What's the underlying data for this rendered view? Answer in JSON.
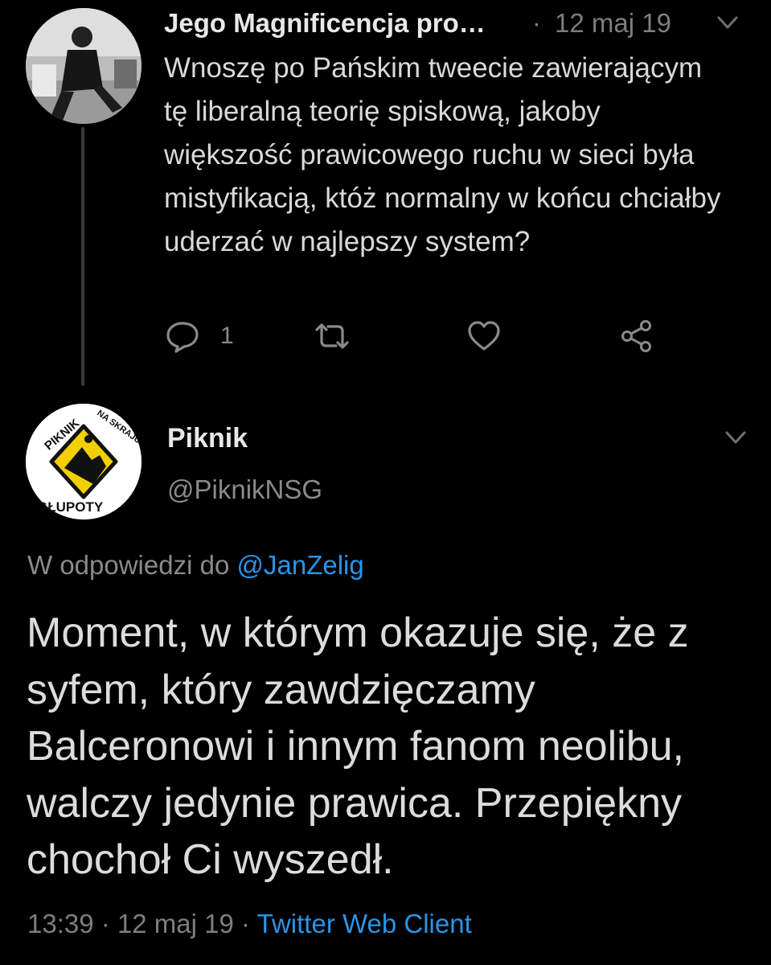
{
  "tweet1": {
    "author_name": "Jego Magnificencja pro…",
    "separator": "·",
    "date": "12 maj 19",
    "text": "Wnoszę po Pańskim tweecie zawierającym tę liberalną teorię spiskową, jakoby większość prawicowego ruchu w sieci była mistyfikacją, któż normalny w końcu chciałby uderzać w najlepszy system?",
    "reply_count": "1",
    "icons": {
      "more": "chevron-down-icon",
      "reply": "reply-icon",
      "retweet": "retweet-icon",
      "like": "heart-icon",
      "share": "share-icon"
    }
  },
  "tweet2": {
    "author_name": "Piknik",
    "handle": "@PiknikNSG",
    "avatar_text": [
      "PIKNIK",
      "NA SKRAJU",
      "GŁUPOTY"
    ],
    "reply_prefix": "W odpowiedzi do",
    "reply_mention": "@JanZelig",
    "text": "Moment, w którym okazuje się, że z syfem, który zawdzięczamy Balceronowi i innym fanom neolibu, walczy jedynie prawica. Przepiękny chochoł Ci wyszedł.",
    "time": "13:39",
    "separator": "·",
    "date": "12 maj 19",
    "separator2": "·",
    "client": "Twitter Web Client"
  },
  "colors": {
    "background": "#000000",
    "text": "#d9d9d9",
    "muted": "#7e7e7e",
    "link": "#2b94e6",
    "avatar_badge_yellow": "#f2cf00"
  }
}
